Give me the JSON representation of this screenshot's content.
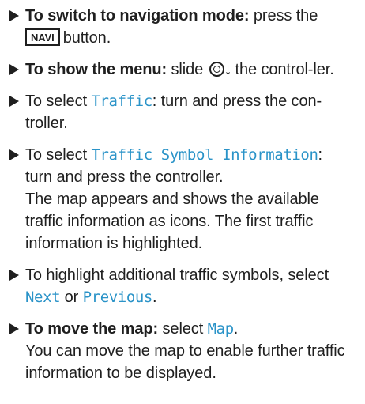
{
  "steps": [
    {
      "bold": "To switch to navigation mode:",
      "text1": " press the",
      "key": "NAVI",
      "text2": "button."
    },
    {
      "bold": "To show the menu:",
      "text1": " slide",
      "arrow": "↓",
      "text2": "the control-ler."
    },
    {
      "text1": "To select ",
      "mono": "Traffic",
      "text2": ": turn and press the con-troller."
    },
    {
      "text1": "To select ",
      "mono": "Traffic Symbol Information",
      "text2": ":",
      "text3": "turn and press the controller.",
      "desc": "The map appears and shows the available traffic information as icons. The first traffic information is highlighted."
    },
    {
      "text1": "To highlight additional traffic symbols, select ",
      "mono1": "Next",
      "text2": " or ",
      "mono2": "Previous",
      "text3": "."
    },
    {
      "bold": "To move the map:",
      "text1": " select ",
      "mono": "Map",
      "text2": ".",
      "desc": "You can move the map to enable further traffic information to be displayed."
    }
  ]
}
